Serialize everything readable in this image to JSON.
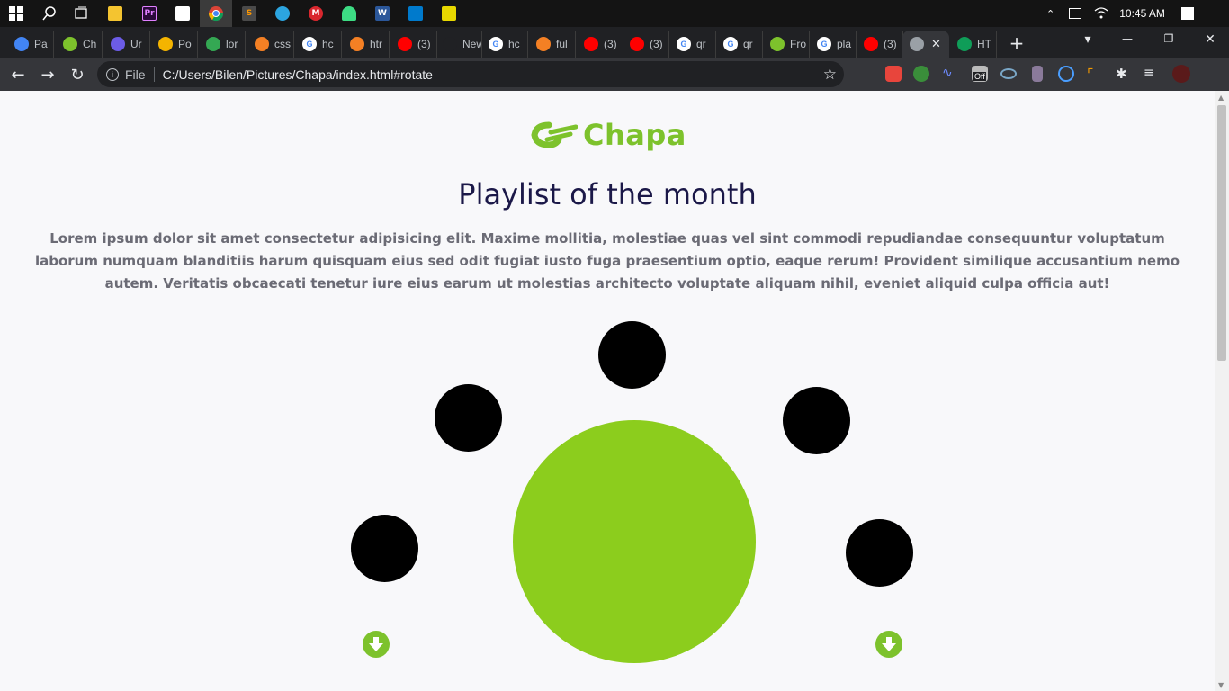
{
  "taskbar": {
    "clock": "10:45 AM"
  },
  "tabs": [
    {
      "label": "Pa",
      "color": "#4285f4"
    },
    {
      "label": "Ch",
      "color": "#7dc22c"
    },
    {
      "label": "Ur",
      "color": "#6c5ce7"
    },
    {
      "label": "Po",
      "color": "#f4b400"
    },
    {
      "label": "lor",
      "color": "#34a853"
    },
    {
      "label": "css",
      "color": "#f48024"
    },
    {
      "label": "hc",
      "color": "#ffffff"
    },
    {
      "label": "htr",
      "color": "#f48024"
    },
    {
      "label": "(3)",
      "color": "#ff0000"
    },
    {
      "label": "New Ta",
      "color": "#202124"
    },
    {
      "label": "hc",
      "color": "#ffffff"
    },
    {
      "label": "ful",
      "color": "#f48024"
    },
    {
      "label": "(3)",
      "color": "#ff0000"
    },
    {
      "label": "(3)",
      "color": "#ff0000"
    },
    {
      "label": "qr",
      "color": "#ffffff"
    },
    {
      "label": "qr",
      "color": "#ffffff"
    },
    {
      "label": "Fro",
      "color": "#7dc22c"
    },
    {
      "label": "pla",
      "color": "#ffffff"
    },
    {
      "label": "(3)",
      "color": "#ff0000"
    },
    {
      "label": "",
      "color": "#9aa0a6"
    },
    {
      "label": "HT",
      "color": "#0f9d58"
    }
  ],
  "toolbar": {
    "file_label": "File",
    "url": "C:/Users/Bilen/Pictures/Chapa/index.html#rotate",
    "ext_off_badge": "Off"
  },
  "page": {
    "logo_text": "Chapa",
    "title": "Playlist of the month",
    "lorem": "Lorem ipsum dolor sit amet consectetur adipisicing elit. Maxime mollitia, molestiae quas vel sint commodi repudiandae consequuntur voluptatum laborum numquam blanditiis harum quisquam eius sed odit fugiat iusto fuga praesentium optio, eaque rerum! Provident similique accusantium nemo autem. Veritatis obcaecati tenetur iure eius earum ut molestias architecto voluptate aliquam nihil, eveniet aliquid culpa officia aut!"
  },
  "colors": {
    "accent": "#8ccd1d",
    "logo_green": "#7dc22c",
    "title": "#1b1848",
    "body_text": "#6b6b75"
  }
}
